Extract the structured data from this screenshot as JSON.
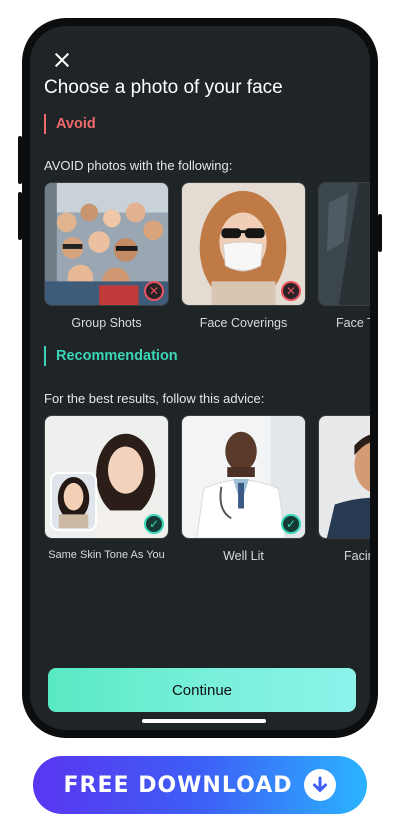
{
  "header": {
    "title": "Choose a photo of your face"
  },
  "avoid": {
    "heading": "Avoid",
    "subtitle": "AVOID photos with the following:",
    "items": [
      {
        "label": "Group Shots",
        "icon": "group-photo"
      },
      {
        "label": "Face Coverings",
        "icon": "masked-face"
      },
      {
        "label": "Face T",
        "icon": "dark-face"
      }
    ]
  },
  "recommendation": {
    "heading": "Recommendation",
    "subtitle": "For the best results, follow this advice:",
    "items": [
      {
        "label": "Same Skin Tone As You",
        "icon": "two-women"
      },
      {
        "label": "Well Lit",
        "icon": "doctor"
      },
      {
        "label": "Facin",
        "icon": "man-facing"
      }
    ]
  },
  "actions": {
    "continue_label": "Continue"
  },
  "promo": {
    "download_label": "FREE DOWNLOAD"
  },
  "colors": {
    "avoid_accent": "#f06a6a",
    "recommend_accent": "#3ad6b8",
    "screen_bg": "#1f2426",
    "continue_gradient": [
      "#58e9c2",
      "#8cf2ea"
    ],
    "download_gradient": [
      "#5a35f0",
      "#2bb3ff"
    ]
  }
}
